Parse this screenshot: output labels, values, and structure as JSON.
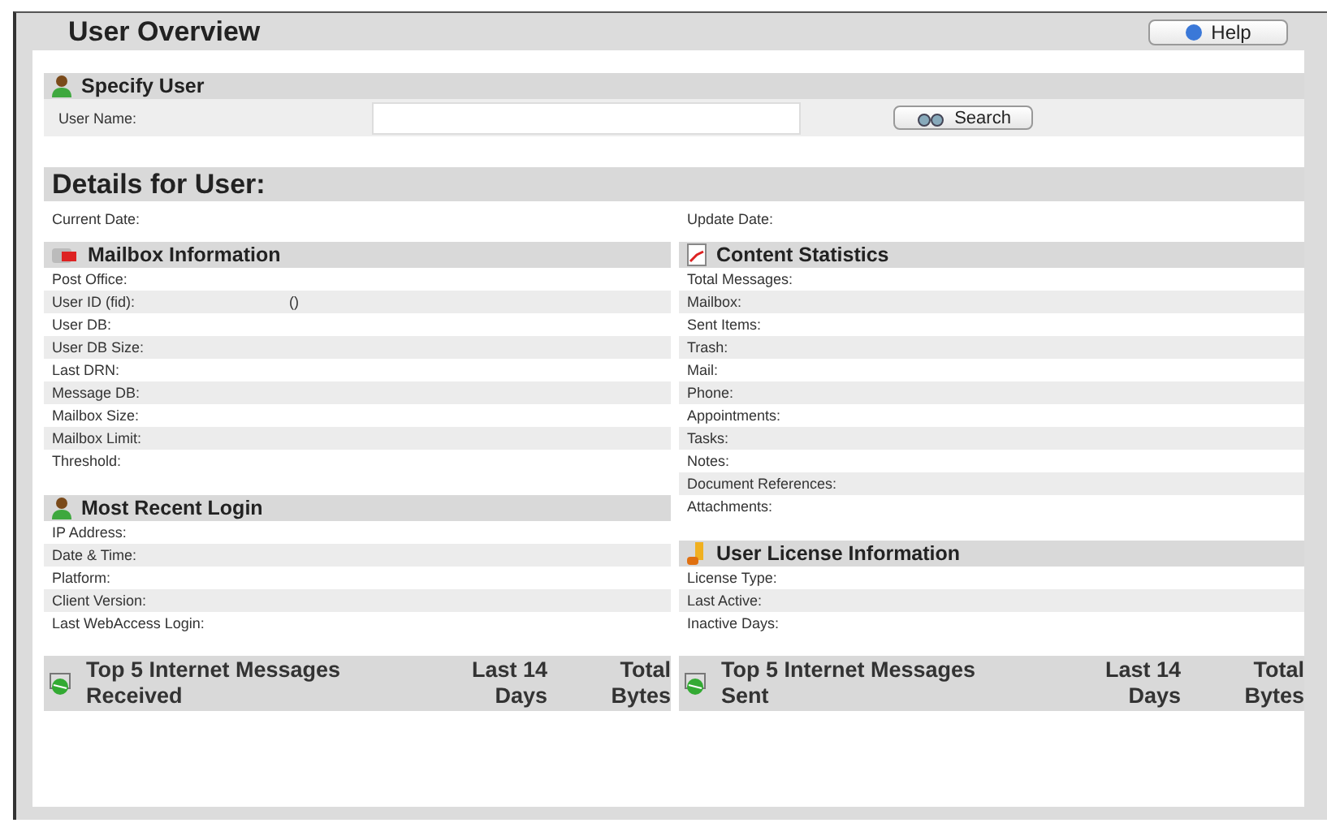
{
  "page_title": "User Overview",
  "help_button": "Help",
  "specify_user": {
    "title": "Specify User",
    "label": "User Name:",
    "search_button": "Search"
  },
  "details_title": "Details for User:",
  "dates": [
    {
      "label": "Current Date:"
    },
    {
      "label": "Update Date:"
    }
  ],
  "left": [
    {
      "title": "Mailbox Information",
      "kind": "mailbox",
      "rows": [
        {
          "label": "Post Office:"
        },
        {
          "label": "User ID (fid):",
          "value": "()"
        },
        {
          "label": "User DB:"
        },
        {
          "label": "User DB Size:"
        },
        {
          "label": "Last DRN:"
        },
        {
          "label": "Message DB:"
        },
        {
          "label": "Mailbox Size:"
        },
        {
          "label": "Mailbox Limit:"
        },
        {
          "label": "Threshold:"
        }
      ]
    },
    {
      "title": "Most Recent Login",
      "kind": "user",
      "rows": [
        {
          "label": "IP Address:"
        },
        {
          "label": "Date & Time:"
        },
        {
          "label": "Platform:"
        },
        {
          "label": "Client Version:"
        },
        {
          "label": "Last WebAccess Login:"
        }
      ]
    }
  ],
  "right": [
    {
      "title": "Content Statistics",
      "kind": "chart",
      "rows": [
        {
          "label": "Total Messages:"
        },
        {
          "label": "Mailbox:"
        },
        {
          "label": "Sent Items:"
        },
        {
          "label": "Trash:"
        },
        {
          "label": "Mail:"
        },
        {
          "label": "Phone:"
        },
        {
          "label": "Appointments:"
        },
        {
          "label": "Tasks:"
        },
        {
          "label": "Notes:"
        },
        {
          "label": "Document References:"
        },
        {
          "label": "Attachments:"
        }
      ]
    },
    {
      "title": "User License Information",
      "kind": "license",
      "rows": [
        {
          "label": "License Type:"
        },
        {
          "label": "Last Active:"
        },
        {
          "label": "Inactive Days:"
        }
      ]
    }
  ],
  "top_tables": [
    {
      "title": "Top 5 Internet Messages Received",
      "columns": [
        "Last 14 Days",
        "Total Bytes"
      ]
    },
    {
      "title": "Top 5 Internet Messages Sent",
      "columns": [
        "Last 14 Days",
        "Total Bytes"
      ]
    }
  ]
}
